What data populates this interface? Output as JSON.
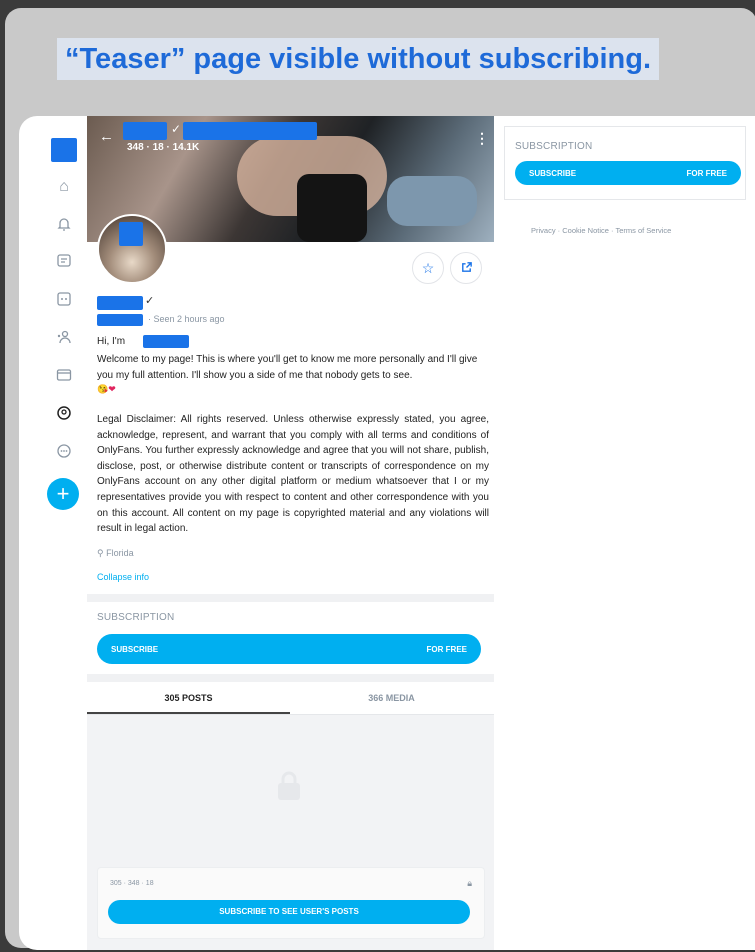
{
  "headline": "“Teaser” page visible without subscribing.",
  "profile": {
    "stats": "348 · 18 · 14.1K",
    "seen": "· Seen 2 hours ago",
    "greeting": "Hi, I'm",
    "bio": "Welcome to my page! This is where you'll get to know me more personally and I'll give you my full attention. I'll show you a side of me that nobody gets to see.",
    "emoji": "😘❤",
    "disclaimer": "Legal Disclaimer: All rights reserved. Unless otherwise expressly stated, you agree, acknowledge, represent, and warrant that you comply with all terms and conditions of OnlyFans. You further expressly acknowledge and agree that you will not share, publish, disclose, post, or otherwise distribute content or transcripts of correspondence on my OnlyFans account on any other digital platform or medium whatsoever that I or my representatives provide you with respect to content and other correspondence with you on this account. All content on my page is copyrighted material and any violations will result in legal action.",
    "location": "Florida",
    "collapse": "Collapse info"
  },
  "subscription": {
    "label": "SUBSCRIPTION",
    "button": "SUBSCRIBE",
    "price": "FOR FREE"
  },
  "tabs": {
    "posts": "305 POSTS",
    "media": "366 MEDIA"
  },
  "teaser": {
    "stats": "305 · 348 · 18",
    "button": "SUBSCRIBE TO SEE USER'S POSTS"
  },
  "footer": {
    "links": "Privacy  ·  Cookie Notice  ·  Terms of Service"
  },
  "colors": {
    "accent": "#00aff0",
    "headline": "#1e6ad8",
    "redaction": "#1a73e8"
  }
}
